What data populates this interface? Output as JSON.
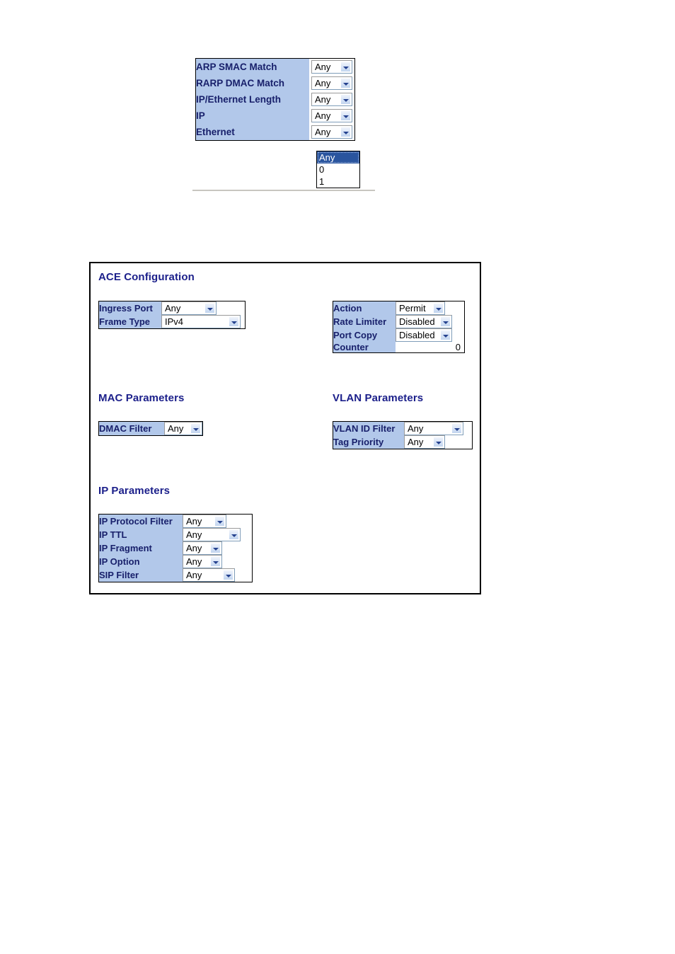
{
  "top_fragment": {
    "rows": [
      {
        "label": "ARP SMAC Match",
        "value": "Any"
      },
      {
        "label": "RARP DMAC Match",
        "value": "Any"
      },
      {
        "label": "IP/Ethernet Length",
        "value": "Any"
      },
      {
        "label": "IP",
        "value": "Any"
      },
      {
        "label": "Ethernet",
        "value": "Any"
      }
    ],
    "open_dropdown": {
      "options": [
        "Any",
        "0",
        "1"
      ],
      "selected": "Any"
    }
  },
  "ace_panel": {
    "title": "ACE Configuration",
    "ace_table": {
      "rows": [
        {
          "label": "Ingress Port",
          "value": "Any"
        },
        {
          "label": "Frame Type",
          "value": "IPv4"
        }
      ]
    },
    "action_table": {
      "rows": [
        {
          "label": "Action",
          "value": "Permit"
        },
        {
          "label": "Rate Limiter",
          "value": "Disabled"
        },
        {
          "label": "Port Copy",
          "value": "Disabled"
        },
        {
          "label": "Counter",
          "value": "0"
        }
      ]
    },
    "mac_parameters": {
      "title": "MAC Parameters",
      "rows": [
        {
          "label": "DMAC Filter",
          "value": "Any"
        }
      ]
    },
    "vlan_parameters": {
      "title": "VLAN Parameters",
      "rows": [
        {
          "label": "VLAN ID Filter",
          "value": "Any"
        },
        {
          "label": "Tag Priority",
          "value": "Any"
        }
      ]
    },
    "ip_parameters": {
      "title": "IP Parameters",
      "rows": [
        {
          "label": "IP Protocol Filter",
          "value": "Any"
        },
        {
          "label": "IP TTL",
          "value": "Any"
        },
        {
          "label": "IP Fragment",
          "value": "Any"
        },
        {
          "label": "IP Option",
          "value": "Any"
        },
        {
          "label": "SIP Filter",
          "value": "Any"
        }
      ]
    }
  },
  "colors": {
    "label_cell": "#b2c8ea",
    "label_text": "#18206b",
    "heading_text": "#1b1f8a",
    "dropdown_highlight": "#29549e",
    "panel_border": "#000000"
  }
}
